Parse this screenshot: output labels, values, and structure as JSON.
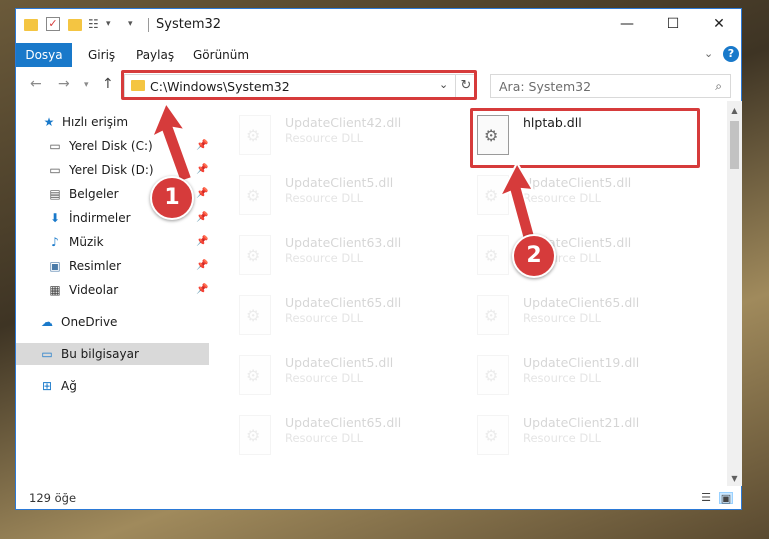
{
  "window": {
    "title": "System32",
    "controls": {
      "minimize": "—",
      "maximize": "☐",
      "close": "✕"
    }
  },
  "ribbon": {
    "file_tab": "Dosya",
    "tabs": [
      "Giriş",
      "Paylaş",
      "Görünüm"
    ],
    "help": "?"
  },
  "address": {
    "path": "C:\\Windows\\System32",
    "search_placeholder": "Ara: System32"
  },
  "nav": {
    "quick_access": "Hızlı erişim",
    "items": [
      {
        "label": "Yerel Disk (C:)",
        "icon": "drive-icon"
      },
      {
        "label": "Yerel Disk (D:)",
        "icon": "drive-icon"
      },
      {
        "label": "Belgeler",
        "icon": "documents-icon"
      },
      {
        "label": "İndirmeler",
        "icon": "downloads-icon"
      },
      {
        "label": "Müzik",
        "icon": "music-icon"
      },
      {
        "label": "Resimler",
        "icon": "pictures-icon"
      },
      {
        "label": "Videolar",
        "icon": "videos-icon"
      }
    ],
    "onedrive": "OneDrive",
    "this_pc": "Bu bilgisayar",
    "network": "Ağ"
  },
  "files": {
    "left": [
      {
        "name": "UpdateClient42.dll",
        "type": "Resource DLL"
      },
      {
        "name": "UpdateClient5.dll",
        "type": "Resource DLL"
      },
      {
        "name": "UpdateClient63.dll",
        "type": "Resource DLL"
      },
      {
        "name": "UpdateClient65.dll",
        "type": "Resource DLL"
      },
      {
        "name": "UpdateClient5.dll",
        "type": "Resource DLL"
      },
      {
        "name": "UpdateClient65.dll",
        "type": "Resource DLL"
      }
    ],
    "highlighted": {
      "name": "hlptab.dll"
    },
    "right": [
      {
        "name": "UpdateClient5.dll",
        "type": "Resource DLL"
      },
      {
        "name": "UpdateClient5.dll",
        "type": "Resource DLL"
      },
      {
        "name": "UpdateClient65.dll",
        "type": "Resource DLL"
      },
      {
        "name": "UpdateClient19.dll",
        "type": "Resource DLL"
      },
      {
        "name": "UpdateClient21.dll",
        "type": "Resource DLL"
      }
    ]
  },
  "status": {
    "count": "129 öğe"
  },
  "annotations": {
    "step1": "1",
    "step2": "2"
  },
  "colors": {
    "accent": "#1979ca",
    "highlight": "#d63b3b",
    "selected": "#d9d9d9"
  }
}
